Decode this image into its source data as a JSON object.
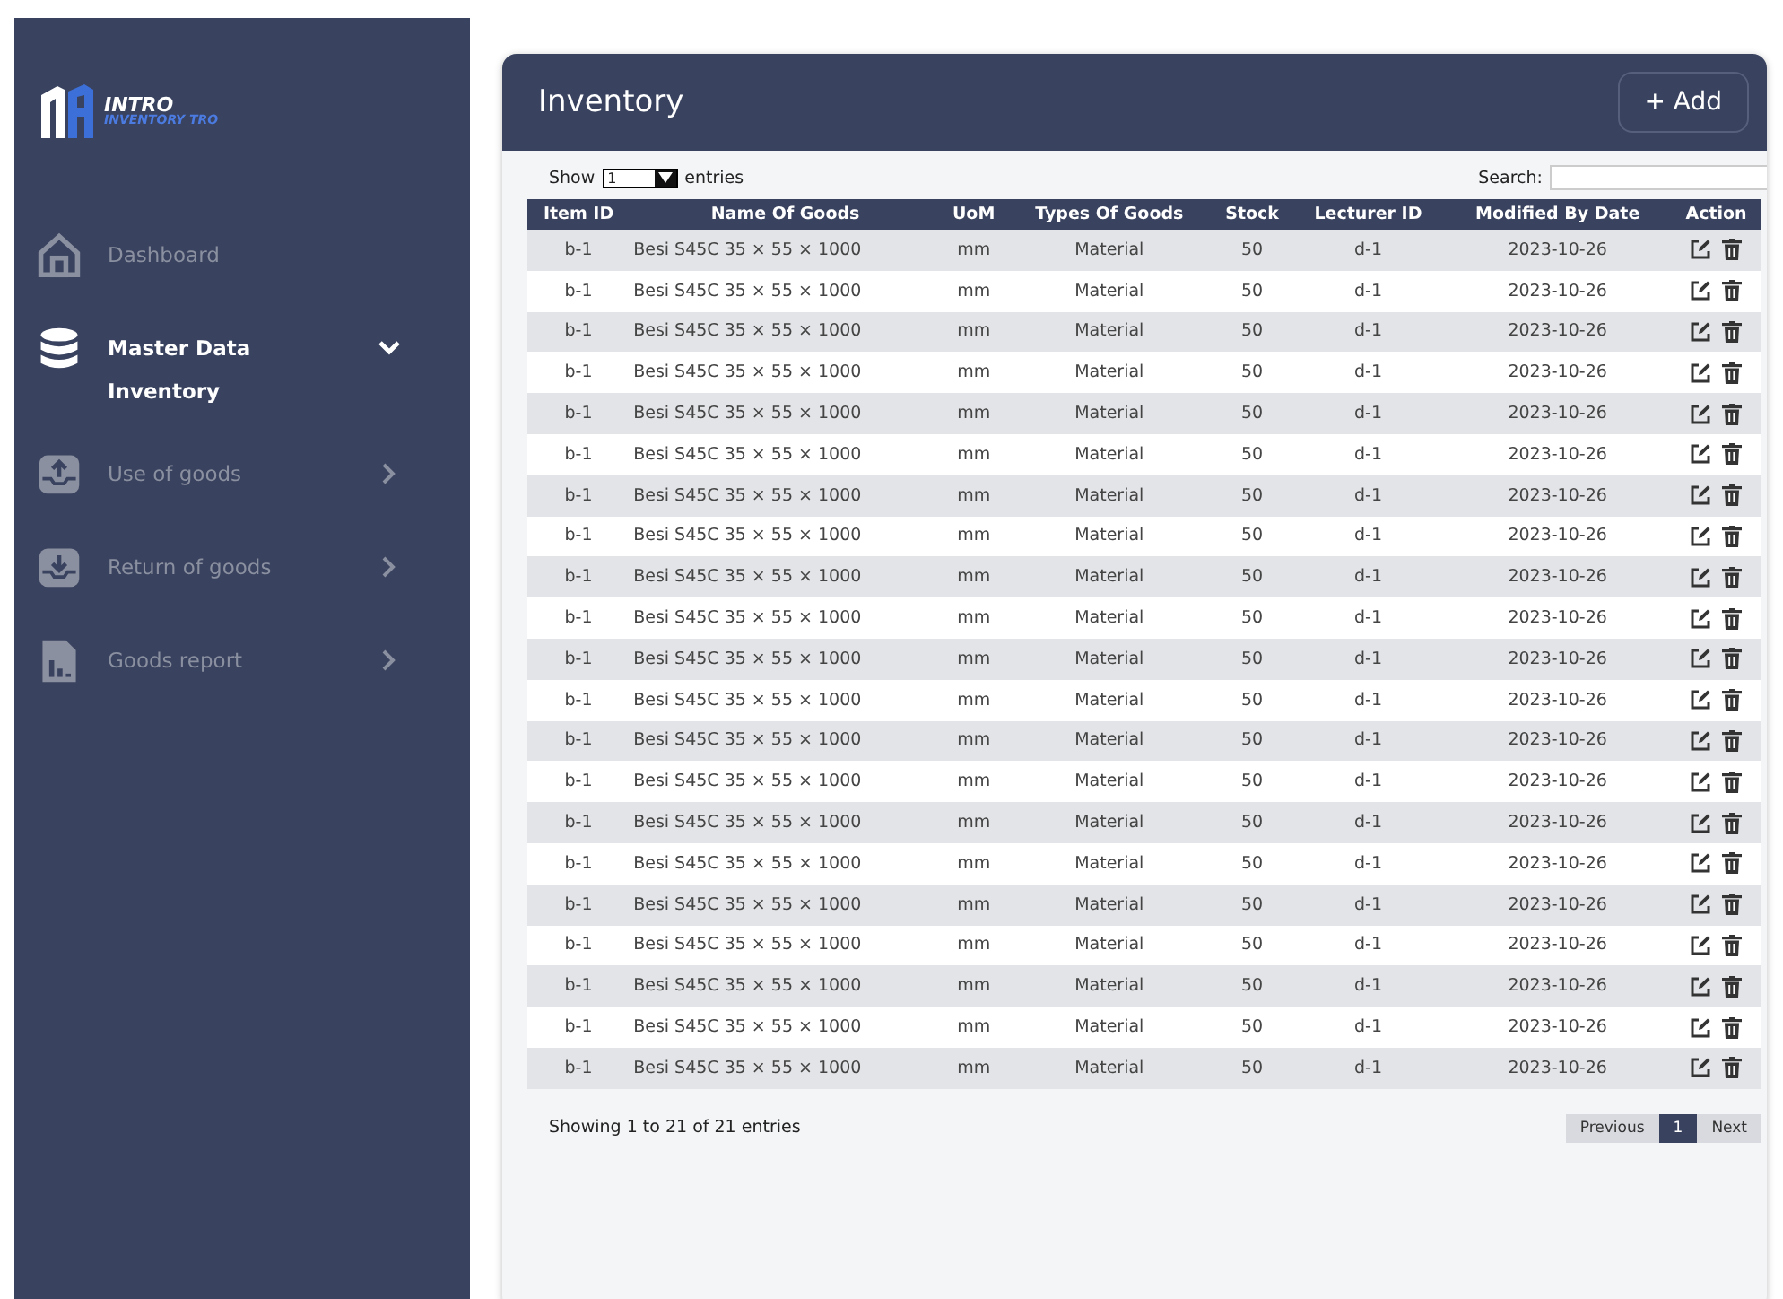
{
  "logo": {
    "title": "INTRO",
    "subtitle": "INVENTORY TRO"
  },
  "sidebar": {
    "items": [
      {
        "label": "Dashboard",
        "selected": false
      },
      {
        "label": "Master Data",
        "selected": true,
        "expanded": true,
        "children": [
          {
            "label": "Inventory",
            "selected": true
          }
        ]
      },
      {
        "label": "Use of goods",
        "selected": false,
        "expanded": false
      },
      {
        "label": "Return of goods",
        "selected": false,
        "expanded": false
      },
      {
        "label": "Goods report",
        "selected": false,
        "expanded": false
      }
    ]
  },
  "header": {
    "title": "Inventory",
    "add_button": "+ Add"
  },
  "controls": {
    "show_label": "Show",
    "entries_value": "1",
    "entries_label": "entries",
    "search_label": "Search:"
  },
  "table": {
    "columns": [
      "Item ID",
      "Name Of Goods",
      "UoM",
      "Types Of Goods",
      "Stock",
      "Lecturer ID",
      "Modified By Date",
      "Action"
    ],
    "rows": [
      [
        "b-1",
        "Besi S45C 35 × 55 × 1000",
        "mm",
        "Material",
        "50",
        "d-1",
        "2023-10-26"
      ],
      [
        "b-1",
        "Besi S45C 35 × 55 × 1000",
        "mm",
        "Material",
        "50",
        "d-1",
        "2023-10-26"
      ],
      [
        "b-1",
        "Besi S45C 35 × 55 × 1000",
        "mm",
        "Material",
        "50",
        "d-1",
        "2023-10-26"
      ],
      [
        "b-1",
        "Besi S45C 35 × 55 × 1000",
        "mm",
        "Material",
        "50",
        "d-1",
        "2023-10-26"
      ],
      [
        "b-1",
        "Besi S45C 35 × 55 × 1000",
        "mm",
        "Material",
        "50",
        "d-1",
        "2023-10-26"
      ],
      [
        "b-1",
        "Besi S45C 35 × 55 × 1000",
        "mm",
        "Material",
        "50",
        "d-1",
        "2023-10-26"
      ],
      [
        "b-1",
        "Besi S45C 35 × 55 × 1000",
        "mm",
        "Material",
        "50",
        "d-1",
        "2023-10-26"
      ],
      [
        "b-1",
        "Besi S45C 35 × 55 × 1000",
        "mm",
        "Material",
        "50",
        "d-1",
        "2023-10-26"
      ],
      [
        "b-1",
        "Besi S45C 35 × 55 × 1000",
        "mm",
        "Material",
        "50",
        "d-1",
        "2023-10-26"
      ],
      [
        "b-1",
        "Besi S45C 35 × 55 × 1000",
        "mm",
        "Material",
        "50",
        "d-1",
        "2023-10-26"
      ],
      [
        "b-1",
        "Besi S45C 35 × 55 × 1000",
        "mm",
        "Material",
        "50",
        "d-1",
        "2023-10-26"
      ],
      [
        "b-1",
        "Besi S45C 35 × 55 × 1000",
        "mm",
        "Material",
        "50",
        "d-1",
        "2023-10-26"
      ],
      [
        "b-1",
        "Besi S45C 35 × 55 × 1000",
        "mm",
        "Material",
        "50",
        "d-1",
        "2023-10-26"
      ],
      [
        "b-1",
        "Besi S45C 35 × 55 × 1000",
        "mm",
        "Material",
        "50",
        "d-1",
        "2023-10-26"
      ],
      [
        "b-1",
        "Besi S45C 35 × 55 × 1000",
        "mm",
        "Material",
        "50",
        "d-1",
        "2023-10-26"
      ],
      [
        "b-1",
        "Besi S45C 35 × 55 × 1000",
        "mm",
        "Material",
        "50",
        "d-1",
        "2023-10-26"
      ],
      [
        "b-1",
        "Besi S45C 35 × 55 × 1000",
        "mm",
        "Material",
        "50",
        "d-1",
        "2023-10-26"
      ],
      [
        "b-1",
        "Besi S45C 35 × 55 × 1000",
        "mm",
        "Material",
        "50",
        "d-1",
        "2023-10-26"
      ],
      [
        "b-1",
        "Besi S45C 35 × 55 × 1000",
        "mm",
        "Material",
        "50",
        "d-1",
        "2023-10-26"
      ],
      [
        "b-1",
        "Besi S45C 35 × 55 × 1000",
        "mm",
        "Material",
        "50",
        "d-1",
        "2023-10-26"
      ],
      [
        "b-1",
        "Besi S45C 35 × 55 × 1000",
        "mm",
        "Material",
        "50",
        "d-1",
        "2023-10-26"
      ]
    ]
  },
  "footer": {
    "info": "Showing 1 to 21 of 21 entries",
    "previous": "Previous",
    "pages": [
      {
        "label": "1",
        "selected": true
      }
    ],
    "next": "Next"
  }
}
